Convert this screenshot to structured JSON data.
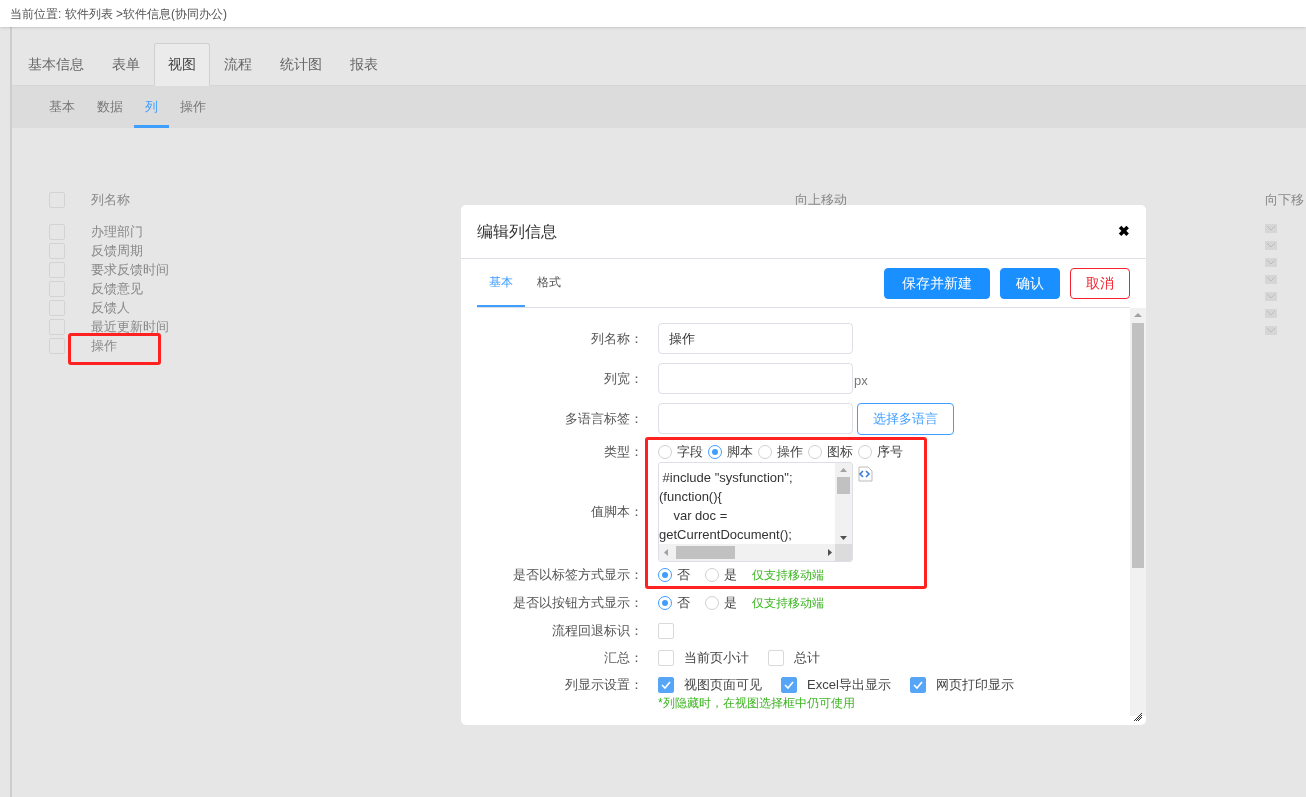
{
  "breadcrumb": "当前位置: 软件列表 >软件信息(协同办公)",
  "tabs": [
    {
      "label": "基本信息",
      "selected": false
    },
    {
      "label": "表单",
      "selected": false
    },
    {
      "label": "视图",
      "selected": true
    },
    {
      "label": "流程",
      "selected": false
    },
    {
      "label": "统计图",
      "selected": false
    },
    {
      "label": "报表",
      "selected": false
    }
  ],
  "subtabs": [
    {
      "label": "基本",
      "selected": false
    },
    {
      "label": "数据",
      "selected": false
    },
    {
      "label": "列",
      "selected": true
    },
    {
      "label": "操作",
      "selected": false
    }
  ],
  "column_list": {
    "header": {
      "label": "列名称",
      "checked": false
    },
    "move_up_header": "向上移动",
    "move_down_header": "向下移",
    "rows": [
      {
        "name": "办理部门",
        "checked": false
      },
      {
        "name": "反馈周期",
        "checked": false
      },
      {
        "name": "要求反馈时间",
        "checked": false
      },
      {
        "name": "反馈意见",
        "checked": false
      },
      {
        "name": "反馈人",
        "checked": false
      },
      {
        "name": "最近更新时间",
        "checked": false
      },
      {
        "name": "操作",
        "checked": false
      }
    ]
  },
  "dialog": {
    "title": "编辑列信息",
    "close": "✖",
    "tabs": [
      {
        "label": "基本",
        "selected": true
      },
      {
        "label": "格式",
        "selected": false
      }
    ],
    "buttons": [
      {
        "label": "保存并新建",
        "kind": "primary"
      },
      {
        "label": "确认",
        "kind": "primary"
      },
      {
        "label": "取消",
        "kind": "danger"
      }
    ],
    "fields": [
      {
        "kind": "text",
        "label": "列名称：",
        "value": "操作"
      },
      {
        "kind": "unit",
        "label": "列宽：",
        "unit": "px"
      },
      {
        "kind": "lang",
        "label": "多语言标签：",
        "button": "选择多语言"
      },
      {
        "kind": "type",
        "label": "类型：",
        "options": [
          {
            "label": "字段",
            "selected": false
          },
          {
            "label": "脚本",
            "selected": true
          },
          {
            "label": "操作",
            "selected": false
          },
          {
            "label": "图标",
            "selected": false
          },
          {
            "label": "序号",
            "selected": false
          }
        ]
      },
      {
        "kind": "script",
        "label": "值脚本：",
        "lines": [
          " #include \"sysfunction\";",
          "(function(){",
          "\tvar doc =",
          "getCurrentDocument();"
        ]
      },
      {
        "kind": "radio",
        "label": "是否以标签方式显示：",
        "options": [
          {
            "label": "否",
            "selected": true
          },
          {
            "label": "是",
            "selected": false
          }
        ],
        "note": "仅支持移动端"
      },
      {
        "kind": "radio",
        "label": "是否以按钮方式显示：",
        "options": [
          {
            "label": "否",
            "selected": true
          },
          {
            "label": "是",
            "selected": false
          }
        ],
        "note": "仅支持移动端"
      },
      {
        "kind": "checkbox",
        "label": "流程回退标识：",
        "checked": false
      },
      {
        "kind": "checks",
        "label": "汇总：",
        "options": [
          {
            "label": "当前页小计",
            "checked": false
          },
          {
            "label": "总计",
            "checked": false
          }
        ]
      },
      {
        "kind": "checks",
        "label": "列显示设置：",
        "options": [
          {
            "label": "视图页面可见",
            "checked": true
          },
          {
            "label": "Excel导出显示",
            "checked": true
          },
          {
            "label": "网页打印显示",
            "checked": true
          }
        ],
        "note": "*列隐藏时，在视图选择框中仍可使用"
      }
    ]
  }
}
